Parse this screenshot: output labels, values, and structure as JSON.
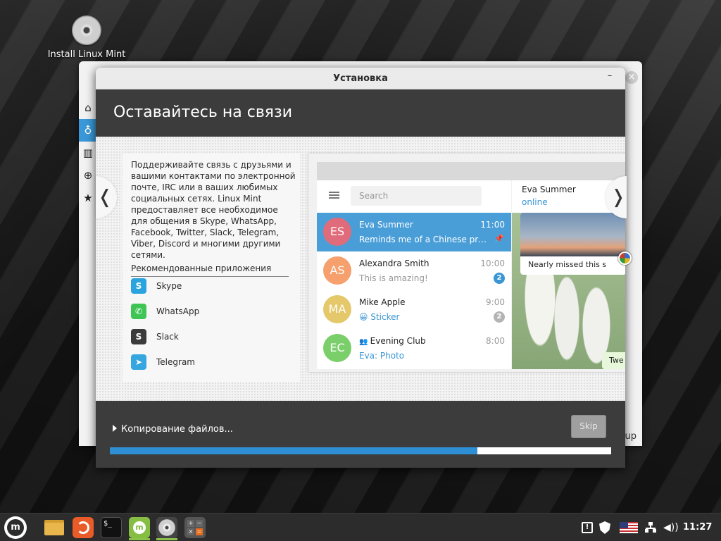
{
  "desktop": {
    "icon_label": "Install Linux Mint"
  },
  "background_window": {
    "partial_text": "up",
    "sidebar_icons": [
      "home-icon",
      "lightbulb-icon",
      "book-icon",
      "lifebuoy-icon",
      "star-icon"
    ]
  },
  "installer": {
    "window_title": "Установка",
    "minimize_symbol": "–",
    "heading": "Оставайтесь на связи",
    "description": "Поддерживайте связь с друзьями и вашими контактами по электронной почте, IRC или в ваших любимых социальных сетях. Linux Mint предоставляет все необходимое для общения в Skype, WhatsApp, Facebook, Twitter, Slack, Telegram, Viber, Discord и многими другими сетями.",
    "recommended_heading": "Рекомендованные приложения",
    "apps": [
      {
        "name": "Skype",
        "icon": "skype-icon",
        "color": "#2aa3de",
        "glyph": "S"
      },
      {
        "name": "WhatsApp",
        "icon": "whatsapp-icon",
        "color": "#3fc556",
        "glyph": "✆"
      },
      {
        "name": "Slack",
        "icon": "slack-icon",
        "color": "#3b3b3b",
        "glyph": "S"
      },
      {
        "name": "Telegram",
        "icon": "telegram-icon",
        "color": "#35a6df",
        "glyph": "➤"
      }
    ],
    "telegram": {
      "search_placeholder": "Search",
      "chats": [
        {
          "initials": "ES",
          "name": "Eva Summer",
          "time": "11:00",
          "message": "Reminds me of a Chinese prover...",
          "color": "#e06b7a",
          "active": true,
          "pinned": true
        },
        {
          "initials": "AS",
          "name": "Alexandra Smith",
          "time": "10:00",
          "message": "This is amazing!",
          "color": "#f5a06d",
          "badge": "2",
          "badge_color": "#3a95d5"
        },
        {
          "initials": "MA",
          "name": "Mike Apple",
          "time": "9:00",
          "message": "😀 Sticker",
          "color": "#e5c86a",
          "badge": "2",
          "badge_color": "#b4b4b4",
          "message_blue": true
        },
        {
          "initials": "EC",
          "name": "Evening Club",
          "time": "8:00",
          "message": "Eva: Photo",
          "color": "#7bcf6a",
          "message_blue": true,
          "group": true
        }
      ],
      "active_contact": "Eva Summer",
      "active_status": "online",
      "photo_caption": "Nearly missed this s",
      "tweet_text": "Twe"
    },
    "nav_prev": "❬",
    "nav_next": "❭",
    "status_text": "Копирование файлов...",
    "skip_label": "Skip",
    "progress_fraction": 0.733
  },
  "taskbar": {
    "clock": "11:27",
    "apps": [
      {
        "name": "files",
        "icon": "folder-icon"
      },
      {
        "name": "firefox",
        "icon": "firefox-icon"
      },
      {
        "name": "terminal",
        "icon": "terminal-icon",
        "glyph": "$_"
      },
      {
        "name": "mintinstall",
        "icon": "mint-install-icon",
        "active": true
      },
      {
        "name": "installer",
        "icon": "disc-icon",
        "active": true
      },
      {
        "name": "calculator",
        "icon": "calculator-icon"
      }
    ]
  }
}
